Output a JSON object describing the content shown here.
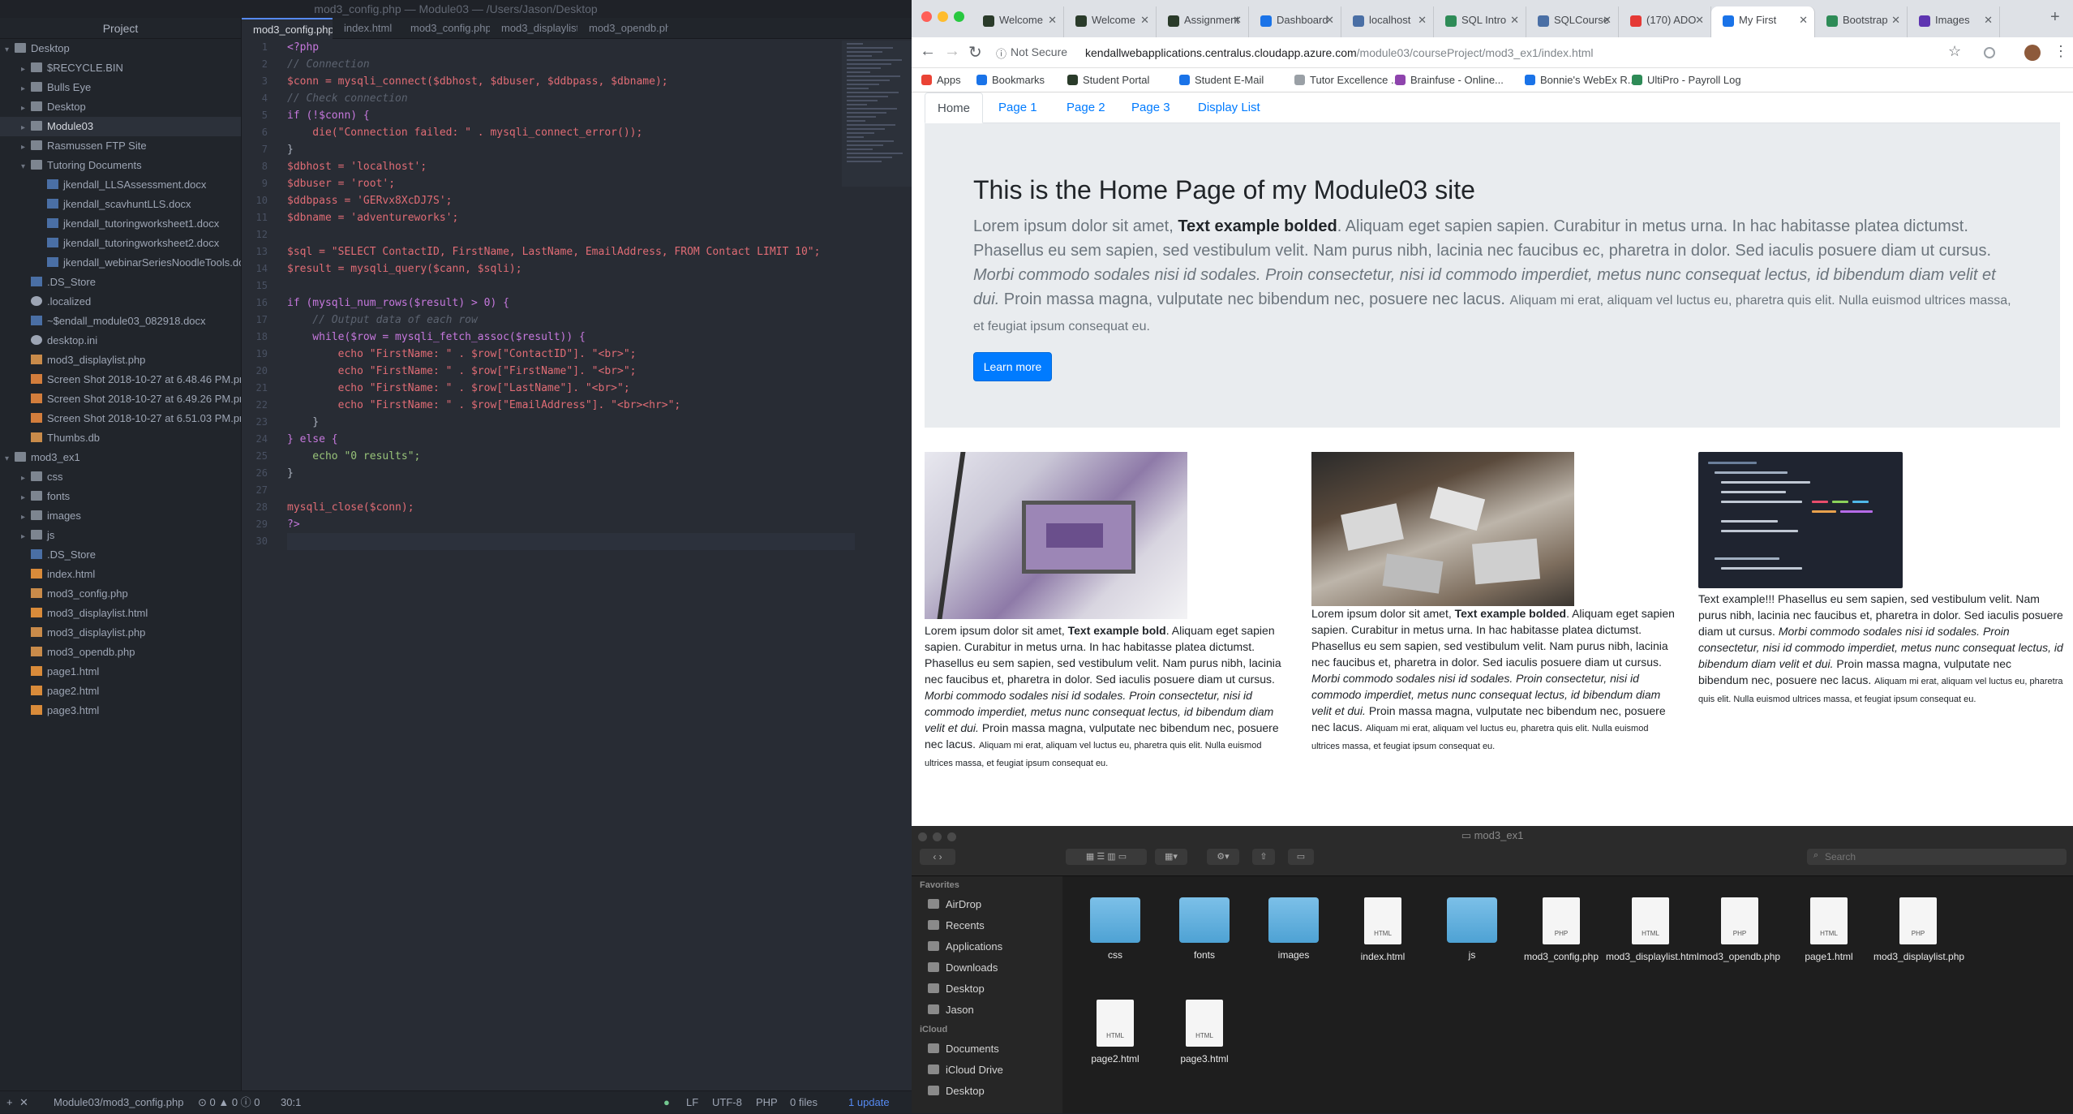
{
  "atom": {
    "title": "mod3_config.php — Module03 — /Users/Jason/Desktop",
    "project_header": "Project",
    "tree": [
      {
        "label": "Desktop",
        "depth": 0,
        "type": "folder",
        "open": true
      },
      {
        "label": "$RECYCLE.BIN",
        "depth": 1,
        "type": "folder"
      },
      {
        "label": "Bulls Eye",
        "depth": 1,
        "type": "folder"
      },
      {
        "label": "Desktop",
        "depth": 1,
        "type": "folder"
      },
      {
        "label": "Module03",
        "depth": 1,
        "type": "folder",
        "selected": true
      },
      {
        "label": "Rasmussen FTP Site",
        "depth": 1,
        "type": "folder"
      },
      {
        "label": "Tutoring Documents",
        "depth": 1,
        "type": "folder",
        "open": true
      },
      {
        "label": "jkendall_LLSAssessment.docx",
        "depth": 2,
        "type": "doc"
      },
      {
        "label": "jkendall_scavhuntLLS.docx",
        "depth": 2,
        "type": "doc"
      },
      {
        "label": "jkendall_tutoringworksheet1.docx",
        "depth": 2,
        "type": "doc"
      },
      {
        "label": "jkendall_tutoringworksheet2.docx",
        "depth": 2,
        "type": "doc"
      },
      {
        "label": "jkendall_webinarSeriesNoodleTools.docx",
        "depth": 2,
        "type": "doc"
      },
      {
        "label": ".DS_Store",
        "depth": 1,
        "type": "doc"
      },
      {
        "label": ".localized",
        "depth": 1,
        "type": "cfg"
      },
      {
        "label": "~$endall_module03_082918.docx",
        "depth": 1,
        "type": "doc"
      },
      {
        "label": "desktop.ini",
        "depth": 1,
        "type": "cfg"
      },
      {
        "label": "mod3_displaylist.php",
        "depth": 1,
        "type": "php"
      },
      {
        "label": "Screen Shot 2018-10-27 at 6.48.46 PM.png",
        "depth": 1,
        "type": "img"
      },
      {
        "label": "Screen Shot 2018-10-27 at 6.49.26 PM.png",
        "depth": 1,
        "type": "img"
      },
      {
        "label": "Screen Shot 2018-10-27 at 6.51.03 PM.png",
        "depth": 1,
        "type": "img"
      },
      {
        "label": "Thumbs.db",
        "depth": 1,
        "type": "php"
      },
      {
        "label": "mod3_ex1",
        "depth": 0,
        "type": "folder",
        "open": true
      },
      {
        "label": "css",
        "depth": 1,
        "type": "folder"
      },
      {
        "label": "fonts",
        "depth": 1,
        "type": "folder"
      },
      {
        "label": "images",
        "depth": 1,
        "type": "folder"
      },
      {
        "label": "js",
        "depth": 1,
        "type": "folder"
      },
      {
        "label": ".DS_Store",
        "depth": 1,
        "type": "doc"
      },
      {
        "label": "index.html",
        "depth": 1,
        "type": "htm"
      },
      {
        "label": "mod3_config.php",
        "depth": 1,
        "type": "php"
      },
      {
        "label": "mod3_displaylist.html",
        "depth": 1,
        "type": "htm"
      },
      {
        "label": "mod3_displaylist.php",
        "depth": 1,
        "type": "php"
      },
      {
        "label": "mod3_opendb.php",
        "depth": 1,
        "type": "php"
      },
      {
        "label": "page1.html",
        "depth": 1,
        "type": "htm"
      },
      {
        "label": "page2.html",
        "depth": 1,
        "type": "htm"
      },
      {
        "label": "page3.html",
        "depth": 1,
        "type": "htm"
      }
    ],
    "tabs": [
      "mod3_config.php — …",
      "index.html",
      "mod3_config.php — …",
      "mod3_displaylist.ht",
      "mod3_opendb.php"
    ],
    "lines": [
      {
        "t": "<?php",
        "c": "kw"
      },
      {
        "t": "// Connection",
        "c": "cmt"
      },
      {
        "t": "$conn = mysqli_connect($dbhost, $dbuser, $ddbpass, $dbname);",
        "c": ""
      },
      {
        "t": "// Check connection",
        "c": "cmt"
      },
      {
        "t": "if (!$conn) {",
        "c": "kw"
      },
      {
        "t": "    die(\"Connection failed: \" . mysqli_connect_error());",
        "c": ""
      },
      {
        "t": "}",
        "c": "txt"
      },
      {
        "t": "$dbhost = 'localhost';",
        "c": ""
      },
      {
        "t": "$dbuser = 'root';",
        "c": ""
      },
      {
        "t": "$ddbpass = 'GERvx8XcDJ7S';",
        "c": ""
      },
      {
        "t": "$dbname = 'adventureworks';",
        "c": ""
      },
      {
        "t": "",
        "c": ""
      },
      {
        "t": "$sql = \"SELECT ContactID, FirstName, LastName, EmailAddress, FROM Contact LIMIT 10\";",
        "c": ""
      },
      {
        "t": "$result = mysqli_query($cann, $sqli);",
        "c": ""
      },
      {
        "t": "",
        "c": ""
      },
      {
        "t": "if (mysqli_num_rows($result) > 0) {",
        "c": "kw"
      },
      {
        "t": "    // Output data of each row",
        "c": "cmt"
      },
      {
        "t": "    while($row = mysqli_fetch_assoc($result)) {",
        "c": "kw"
      },
      {
        "t": "        echo \"FirstName: \" . $row[\"ContactID\"]. \"<br>\";",
        "c": ""
      },
      {
        "t": "        echo \"FirstName: \" . $row[\"FirstName\"]. \"<br>\";",
        "c": ""
      },
      {
        "t": "        echo \"FirstName: \" . $row[\"LastName\"]. \"<br>\";",
        "c": ""
      },
      {
        "t": "        echo \"FirstName: \" . $row[\"EmailAddress\"]. \"<br><hr>\";",
        "c": ""
      },
      {
        "t": "    }",
        "c": "txt"
      },
      {
        "t": "} else {",
        "c": "kw"
      },
      {
        "t": "    echo \"0 results\";",
        "c": "str"
      },
      {
        "t": "}",
        "c": "txt"
      },
      {
        "t": "",
        "c": ""
      },
      {
        "t": "mysqli_close($conn);",
        "c": ""
      },
      {
        "t": "?>",
        "c": "kw"
      },
      {
        "t": "",
        "c": "cur"
      }
    ],
    "status": {
      "path": "Module03/mod3_config.php",
      "diag": "⊙ 0 ▲ 0 ⓘ 0",
      "cursor": "30:1",
      "eol": "LF",
      "encoding": "UTF-8",
      "grammar": "PHP",
      "files": "0 files",
      "update": "1 update"
    }
  },
  "browser": {
    "tabs": [
      {
        "label": "Welcome",
        "color": "#2a3b2a"
      },
      {
        "label": "Welcome",
        "color": "#2a3b2a"
      },
      {
        "label": "Assignment",
        "color": "#2a3b2a"
      },
      {
        "label": "Dashboard",
        "color": "#1a73e8"
      },
      {
        "label": "localhost",
        "color": "#4a6fa5"
      },
      {
        "label": "SQL Intro",
        "color": "#2e8b57"
      },
      {
        "label": "SQLCourse",
        "color": "#4a6fa5"
      },
      {
        "label": "(170) ADO",
        "color": "#e53935"
      },
      {
        "label": "My First",
        "color": "#1a73e8",
        "active": true
      },
      {
        "label": "Bootstrap",
        "color": "#2e8b57"
      },
      {
        "label": "Images",
        "color": "#5e35b1"
      }
    ],
    "not_secure": "Not Secure",
    "url_host": "kendallwebapplications.centralus.cloudapp.azure.com",
    "url_path": "/module03/courseProject/mod3_ex1/index.html",
    "bookmarks": [
      {
        "label": "Apps",
        "color": "#ea4335"
      },
      {
        "label": "Bookmarks",
        "color": "#1a73e8"
      },
      {
        "label": "Student Portal",
        "color": "#2a3b2a"
      },
      {
        "label": "Student E-Mail",
        "color": "#1a73e8"
      },
      {
        "label": "Tutor Excellence ...",
        "color": "#9aa0a6"
      },
      {
        "label": "Brainfuse - Online...",
        "color": "#8e44ad"
      },
      {
        "label": "Bonnie's WebEx R...",
        "color": "#1a73e8"
      },
      {
        "label": "UltiPro - Payroll Log",
        "color": "#2e8b57"
      }
    ],
    "nav": [
      "Home",
      "Page 1",
      "Page 2",
      "Page 3",
      "Display List"
    ],
    "jumbo_title": "This is the Home Page of my Module03 site",
    "lead_1": "Lorem ipsum dolor sit amet, ",
    "lead_bold": "Text example bolded",
    "lead_2": ". Aliquam eget sapien sapien. Curabitur in metus urna. In hac habitasse platea dictumst. Phasellus eu sem sapien, sed vestibulum velit. Nam purus nibh, lacinia nec faucibus ec, pharetra in dolor. Sed iaculis posuere diam ut cursus. ",
    "lead_it": "Morbi commodo sodales nisi id sodales. Proin consectetur, nisi id commodo imperdiet, metus nunc consequat lectus, id bibendum diam velit et dui.",
    "lead_3": " Proin massa magna, vulputate nec bibendum nec, posuere nec lacus. ",
    "lead_small": "Aliquam mi erat, aliquam vel luctus eu, pharetra quis elit. Nulla euismod ultrices massa, et feugiat ipsum consequat eu.",
    "learn_more": "Learn more",
    "col1": {
      "a": "Lorem ipsum dolor sit amet, ",
      "b": "Text example bold",
      "c": ". Aliquam eget sapien sapien. Curabitur in metus urna. In hac habitasse platea dictumst. Phasellus eu sem sapien, sed vestibulum velit. Nam purus nibh, lacinia nec faucibus et, pharetra in dolor. Sed iaculis posuere diam ut cursus. ",
      "i": "Morbi commodo sodales nisi id sodales. Proin consectetur, nisi id commodo imperdiet, metus nunc consequat lectus, id bibendum diam velit et dui.",
      "d": " Proin massa magna, vulputate nec bibendum nec, posuere nec lacus. ",
      "s": "Aliquam mi erat, aliquam vel luctus eu, pharetra quis elit. Nulla euismod ultrices massa, et feugiat ipsum consequat eu."
    },
    "col2": {
      "a": "Lorem ipsum dolor sit amet, ",
      "b": "Text example bolded",
      "c": ". Aliquam eget sapien sapien. Curabitur in metus urna. In hac habitasse platea dictumst. Phasellus eu sem sapien, sed vestibulum velit. Nam purus nibh, lacinia nec faucibus et, pharetra in dolor. Sed iaculis posuere diam ut cursus. ",
      "i": "Morbi commodo sodales nisi id sodales. Proin consectetur, nisi id commodo imperdiet, metus nunc consequat lectus, id bibendum diam velit et dui.",
      "d": " Proin massa magna, vulputate nec bibendum nec, posuere nec lacus. ",
      "s": "Aliquam mi erat, aliquam vel luctus eu, pharetra quis elit. Nulla euismod ultrices massa, et feugiat ipsum consequat eu."
    },
    "col3": {
      "a": "Text example!!! Phasellus eu sem sapien, sed vestibulum velit. Nam purus nibh, lacinia nec faucibus et, pharetra in dolor. Sed iaculis posuere diam ut cursus. ",
      "i": "Morbi commodo sodales nisi id sodales. Proin consectetur, nisi id commodo imperdiet, metus nunc consequat lectus, id bibendum diam velit et dui.",
      "d": " Proin massa magna, vulputate nec bibendum nec, posuere nec lacus. ",
      "s": "Aliquam mi erat, aliquam vel luctus eu, pharetra quis elit. Nulla euismod ultrices massa, et feugiat ipsum consequat eu."
    }
  },
  "finder": {
    "title": "mod3_ex1",
    "search_placeholder": "Search",
    "favorites_header": "Favorites",
    "favorites": [
      "AirDrop",
      "Recents",
      "Applications",
      "Downloads",
      "Desktop",
      "Jason"
    ],
    "icloud_header": "iCloud",
    "icloud": [
      "Documents",
      "iCloud Drive",
      "Desktop"
    ],
    "items": [
      {
        "name": "css",
        "kind": "folder"
      },
      {
        "name": "fonts",
        "kind": "folder"
      },
      {
        "name": "images",
        "kind": "folder"
      },
      {
        "name": "index.html",
        "kind": "file",
        "ext": "HTML"
      },
      {
        "name": "js",
        "kind": "folder"
      },
      {
        "name": "mod3_config.php",
        "kind": "file",
        "ext": "PHP"
      },
      {
        "name": "mod3_displaylist.html",
        "kind": "file",
        "ext": "HTML"
      },
      {
        "name": "mod3_opendb.php",
        "kind": "file",
        "ext": "PHP"
      },
      {
        "name": "page1.html",
        "kind": "file",
        "ext": "HTML"
      },
      {
        "name": "mod3_displaylist.php",
        "kind": "file",
        "ext": "PHP"
      },
      {
        "name": "page2.html",
        "kind": "file",
        "ext": "HTML"
      },
      {
        "name": "page3.html",
        "kind": "file",
        "ext": "HTML"
      }
    ]
  }
}
